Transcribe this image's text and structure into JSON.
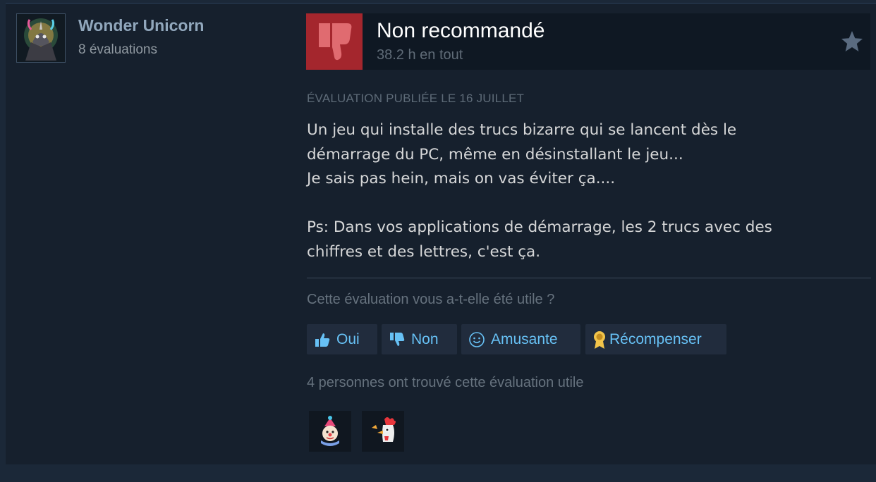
{
  "author": {
    "name": "Wonder Unicorn",
    "review_count": "8 évaluations",
    "avatar_icon": "unicorn-avatar-icon"
  },
  "review": {
    "verdict": "Non recommandé",
    "verdict_icon": "thumbs-down-icon",
    "hours": "38.2 h en tout",
    "posted": "ÉVALUATION PUBLIÉE LE 16 JUILLET",
    "lines": [
      "Un jeu qui installe des trucs bizarre qui se lancent dès le",
      "démarrage du PC, même en désinstallant le jeu...",
      "Je sais pas hein, mais on vas éviter ça....",
      "",
      "Ps: Dans vos applications de démarrage, les 2 trucs avec des",
      "chiffres et des lettres, c'est ça."
    ]
  },
  "feedback": {
    "question": "Cette évaluation vous a-t-elle été utile ?",
    "yes_label": "Oui",
    "no_label": "Non",
    "funny_label": "Amusante",
    "award_label": "Récompenser",
    "helpful_count_text": "4 personnes ont trouvé cette évaluation utile"
  },
  "awards": [
    {
      "icon": "clown-award-icon"
    },
    {
      "icon": "rooster-award-icon"
    }
  ],
  "colors": {
    "background": "#1b2838",
    "panel": "#16202d",
    "header": "#0f1823",
    "thumb_down_bg": "#a4262d",
    "link_blue": "#67c1f5",
    "button_bg": "#212c3d"
  }
}
